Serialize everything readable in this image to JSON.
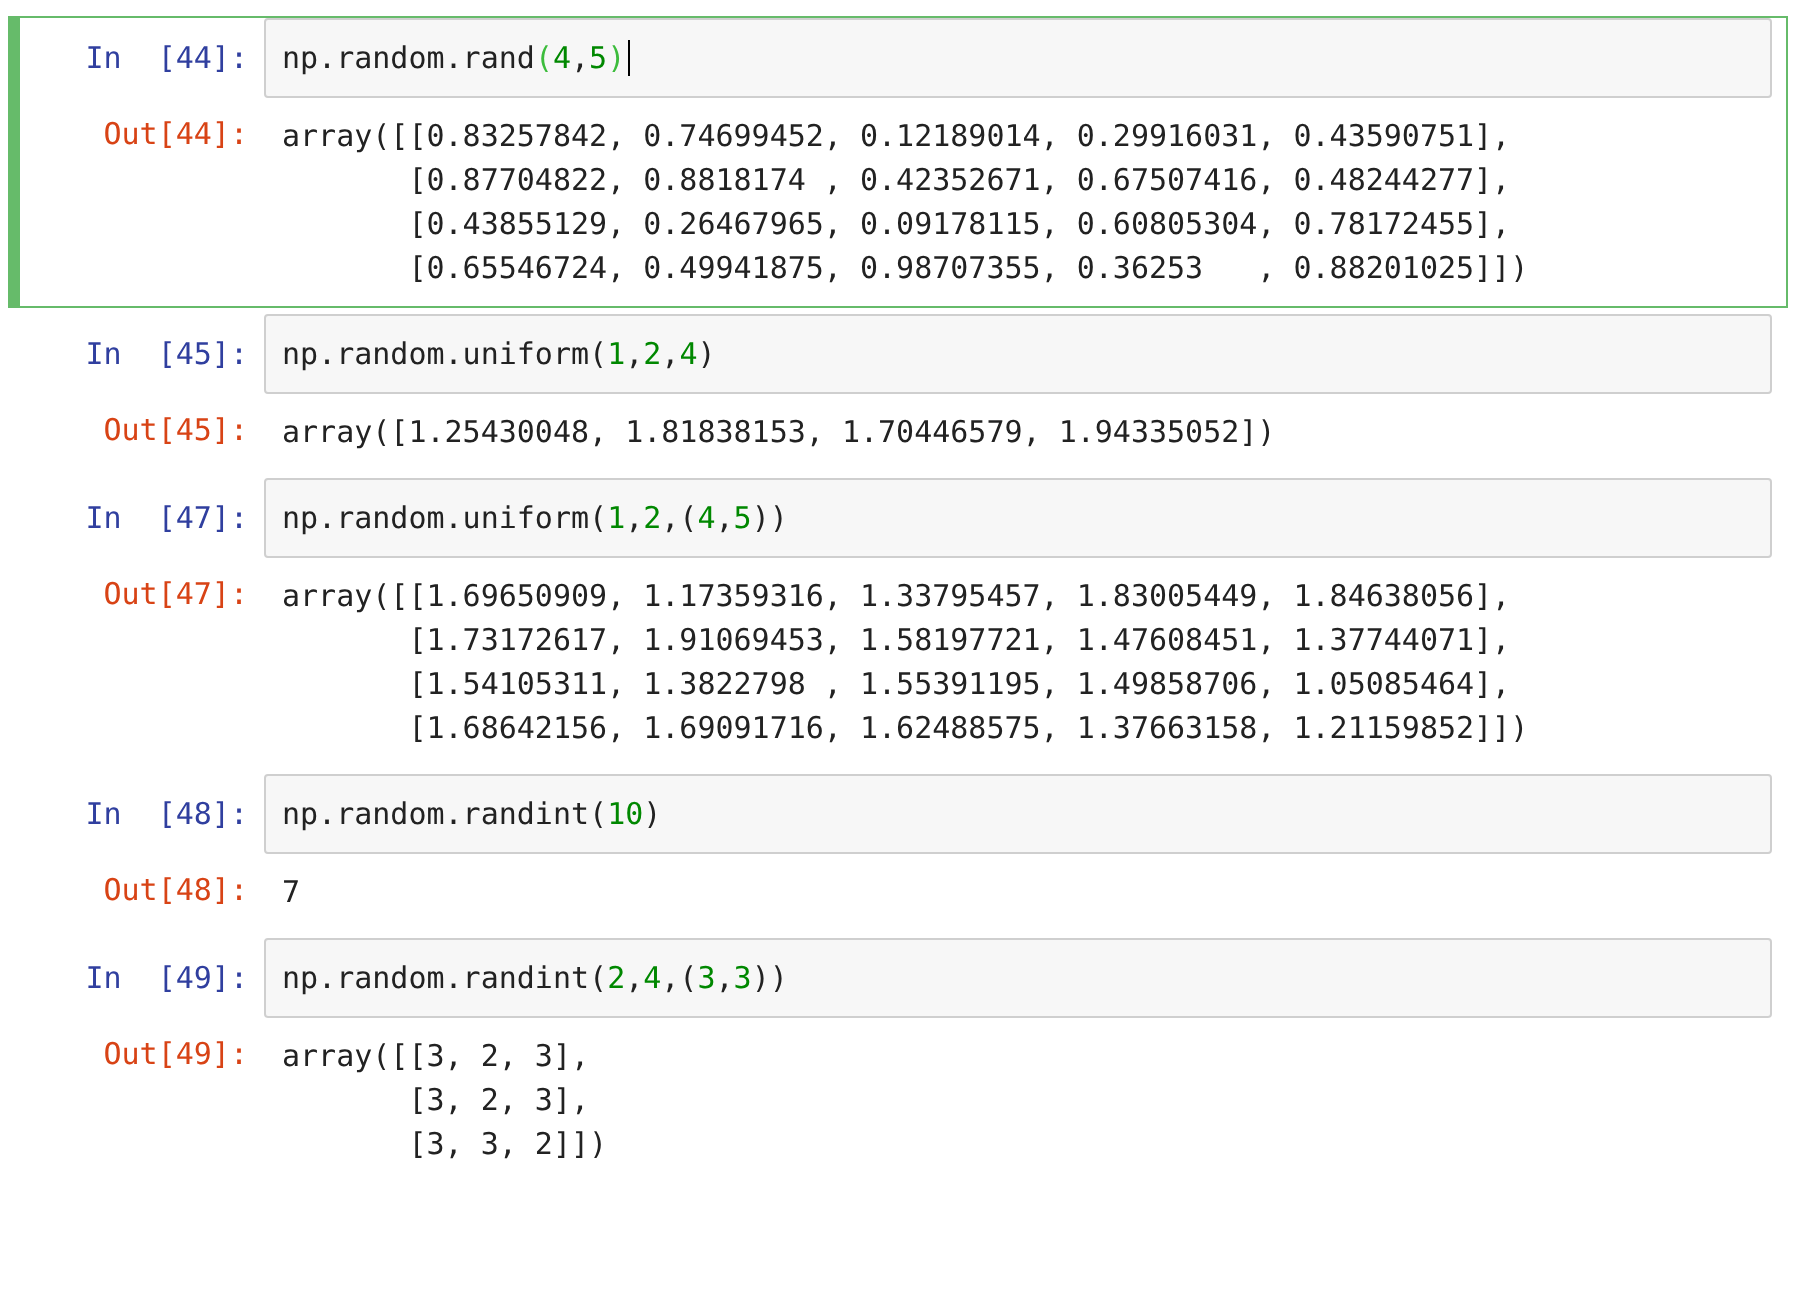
{
  "cells": [
    {
      "in_prompt": "In  [44]:",
      "selected": true,
      "code": [
        {
          "text": "np.random.rand",
          "kind": "text"
        },
        {
          "text": "(",
          "kind": "match"
        },
        {
          "text": "4",
          "kind": "number"
        },
        {
          "text": ",",
          "kind": "text"
        },
        {
          "text": "5",
          "kind": "number"
        },
        {
          "text": ")",
          "kind": "match"
        }
      ],
      "out_prompt": "Out[44]:",
      "output": [
        "array([[0.83257842, 0.74699452, 0.12189014, 0.29916031, 0.43590751],",
        "       [0.87704822, 0.8818174 , 0.42352671, 0.67507416, 0.48244277],",
        "       [0.43855129, 0.26467965, 0.09178115, 0.60805304, 0.78172455],",
        "       [0.65546724, 0.49941875, 0.98707355, 0.36253   , 0.88201025]])"
      ]
    },
    {
      "in_prompt": "In  [45]:",
      "selected": false,
      "code": [
        {
          "text": "np.random.uniform(",
          "kind": "text"
        },
        {
          "text": "1",
          "kind": "number"
        },
        {
          "text": ",",
          "kind": "text"
        },
        {
          "text": "2",
          "kind": "number"
        },
        {
          "text": ",",
          "kind": "text"
        },
        {
          "text": "4",
          "kind": "number"
        },
        {
          "text": ")",
          "kind": "text"
        }
      ],
      "out_prompt": "Out[45]:",
      "output": [
        "array([1.25430048, 1.81838153, 1.70446579, 1.94335052])"
      ]
    },
    {
      "in_prompt": "In  [47]:",
      "selected": false,
      "code": [
        {
          "text": "np.random.uniform(",
          "kind": "text"
        },
        {
          "text": "1",
          "kind": "number"
        },
        {
          "text": ",",
          "kind": "text"
        },
        {
          "text": "2",
          "kind": "number"
        },
        {
          "text": ",(",
          "kind": "text"
        },
        {
          "text": "4",
          "kind": "number"
        },
        {
          "text": ",",
          "kind": "text"
        },
        {
          "text": "5",
          "kind": "number"
        },
        {
          "text": "))",
          "kind": "text"
        }
      ],
      "out_prompt": "Out[47]:",
      "output": [
        "array([[1.69650909, 1.17359316, 1.33795457, 1.83005449, 1.84638056],",
        "       [1.73172617, 1.91069453, 1.58197721, 1.47608451, 1.37744071],",
        "       [1.54105311, 1.3822798 , 1.55391195, 1.49858706, 1.05085464],",
        "       [1.68642156, 1.69091716, 1.62488575, 1.37663158, 1.21159852]])"
      ]
    },
    {
      "in_prompt": "In  [48]:",
      "selected": false,
      "code": [
        {
          "text": "np.random.randint(",
          "kind": "text"
        },
        {
          "text": "10",
          "kind": "number"
        },
        {
          "text": ")",
          "kind": "text"
        }
      ],
      "out_prompt": "Out[48]:",
      "output": [
        "7"
      ]
    },
    {
      "in_prompt": "In  [49]:",
      "selected": false,
      "code": [
        {
          "text": "np.random.randint(",
          "kind": "text"
        },
        {
          "text": "2",
          "kind": "number"
        },
        {
          "text": ",",
          "kind": "text"
        },
        {
          "text": "4",
          "kind": "number"
        },
        {
          "text": ",(",
          "kind": "text"
        },
        {
          "text": "3",
          "kind": "number"
        },
        {
          "text": ",",
          "kind": "text"
        },
        {
          "text": "3",
          "kind": "number"
        },
        {
          "text": "))",
          "kind": "text"
        }
      ],
      "out_prompt": "Out[49]:",
      "output": [
        "array([[3, 2, 3],",
        "       [3, 2, 3],",
        "       [3, 3, 2]])"
      ]
    }
  ]
}
